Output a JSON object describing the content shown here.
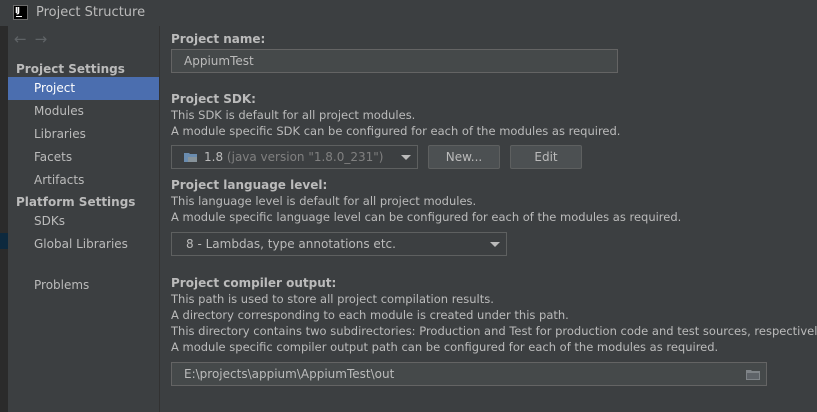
{
  "window": {
    "title": "Project Structure",
    "icon": "intellij-idea-icon",
    "icon_text": "IJ"
  },
  "nav": {
    "back_icon": "arrow-left-icon",
    "forward_icon": "arrow-right-icon",
    "back_glyph": "←",
    "forward_glyph": "→"
  },
  "sidebar": {
    "project_settings_header": "Project Settings",
    "platform_settings_header": "Platform Settings",
    "project_items": [
      {
        "label": "Project",
        "selected": true
      },
      {
        "label": "Modules"
      },
      {
        "label": "Libraries"
      },
      {
        "label": "Facets"
      },
      {
        "label": "Artifacts"
      }
    ],
    "platform_items": [
      {
        "label": "SDKs"
      },
      {
        "label": "Global Libraries"
      }
    ],
    "problems": "Problems"
  },
  "main": {
    "project_name": {
      "label": "Project name:",
      "value": "AppiumTest"
    },
    "project_sdk": {
      "label": "Project SDK:",
      "desc": [
        "This SDK is default for all project modules.",
        "A module specific SDK can be configured for each of the modules as required."
      ],
      "selected_name": "1.8",
      "selected_detail": "(java version \"1.8.0_231\")",
      "new_button": "New...",
      "edit_button": "Edit"
    },
    "language_level": {
      "label": "Project language level:",
      "desc": [
        "This language level is default for all project modules.",
        "A module specific language level can be configured for each of the modules as required."
      ],
      "selected": "8 - Lambdas, type annotations etc."
    },
    "compiler_output": {
      "label": "Project compiler output:",
      "desc": [
        "This path is used to store all project compilation results.",
        "A directory corresponding to each module is created under this path.",
        "This directory contains two subdirectories: Production and Test for production code and test sources, respectively.",
        "A module specific compiler output path can be configured for each of the modules as required."
      ],
      "value": "E:\\projects\\appium\\AppiumTest\\out"
    }
  },
  "colors": {
    "background": "#3c3f41",
    "selection": "#4b6eaf",
    "text": "#bbbbbb",
    "field": "#45494a"
  }
}
